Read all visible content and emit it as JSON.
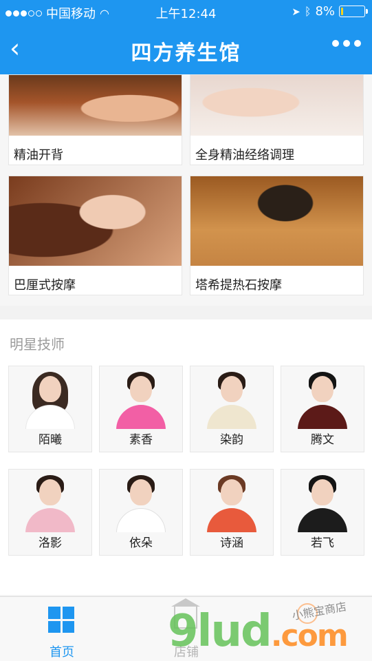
{
  "status_bar": {
    "carrier": "中国移动",
    "time": "上午12:44",
    "battery": "8%",
    "signal_dots_filled": 3,
    "signal_dots_total": 5,
    "battery_level": 0.08
  },
  "nav": {
    "back_icon": "chevron-left-icon",
    "title": "四方养生馆",
    "more_icon": "more-dots-icon"
  },
  "services": [
    {
      "label": "精油开背"
    },
    {
      "label": "全身精油经络调理"
    },
    {
      "label": "巴厘式按摩"
    },
    {
      "label": "塔希提热石按摩"
    }
  ],
  "technicians": {
    "heading": "明星技师",
    "items": [
      {
        "name": "陌曦"
      },
      {
        "name": "素香"
      },
      {
        "name": "染韵"
      },
      {
        "name": "腾文"
      },
      {
        "name": "洛影"
      },
      {
        "name": "依朵"
      },
      {
        "name": "诗涵"
      },
      {
        "name": "若飞"
      }
    ]
  },
  "tabbar": {
    "tabs": [
      {
        "label": "首页",
        "active": true,
        "icon": "grid-icon"
      },
      {
        "label": "店铺",
        "active": false,
        "icon": "shop-icon"
      }
    ],
    "active_color": "#1e96f0"
  },
  "watermark": {
    "brand": "9lud",
    "suffix": ".com",
    "signature": "小熊宝商店"
  },
  "colors": {
    "header": "#1e96f0",
    "background": "#f2f2f2"
  }
}
